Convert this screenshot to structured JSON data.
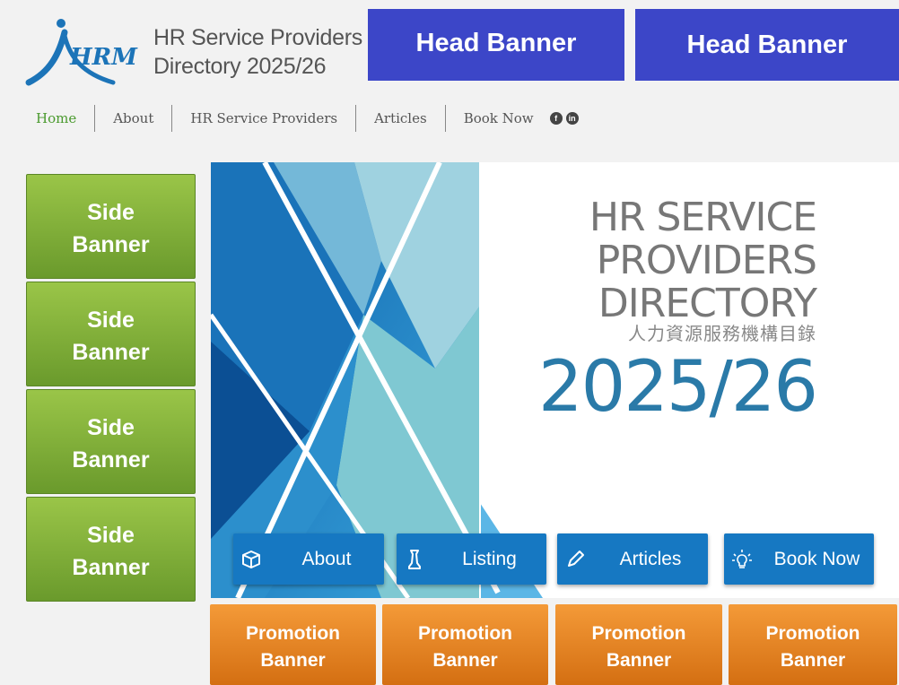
{
  "logo": {
    "mark_text": "HRM",
    "title_line1": "HR Service Providers",
    "title_line2": "Directory 2025/26"
  },
  "head_banners": [
    "Head Banner",
    "Head Banner"
  ],
  "nav": {
    "items": [
      "Home",
      "About",
      "HR Service Providers",
      "Articles",
      "Book Now"
    ],
    "active": "Home",
    "social": [
      "f",
      "in"
    ]
  },
  "side_banners": [
    {
      "line1": "Side",
      "line2": "Banner"
    },
    {
      "line1": "Side",
      "line2": "Banner"
    },
    {
      "line1": "Side",
      "line2": "Banner"
    },
    {
      "line1": "Side",
      "line2": "Banner"
    }
  ],
  "hero": {
    "line1": "HR SERVICE",
    "line2": "PROVIDERS",
    "line3": "DIRECTORY",
    "subtitle_zh": "人力資源服務機構目錄",
    "year": "2025/26",
    "buttons": [
      {
        "label": "About",
        "icon": "box-icon"
      },
      {
        "label": "Listing",
        "icon": "chess-piece-icon"
      },
      {
        "label": "Articles",
        "icon": "pencil-icon"
      },
      {
        "label": "Book Now",
        "icon": "lightbulb-icon"
      }
    ]
  },
  "promo_banners": [
    {
      "line1": "Promotion",
      "line2": "Banner"
    },
    {
      "line1": "Promotion",
      "line2": "Banner"
    },
    {
      "line1": "Promotion",
      "line2": "Banner"
    },
    {
      "line1": "Promotion",
      "line2": "Banner"
    }
  ],
  "colors": {
    "head_banner": "#3c46c8",
    "side_banner": "#8ab93e",
    "promo_banner": "#e8821f",
    "hero_button": "#1678c2",
    "nav_active": "#4a9a2e",
    "year": "#2a7aa8"
  }
}
